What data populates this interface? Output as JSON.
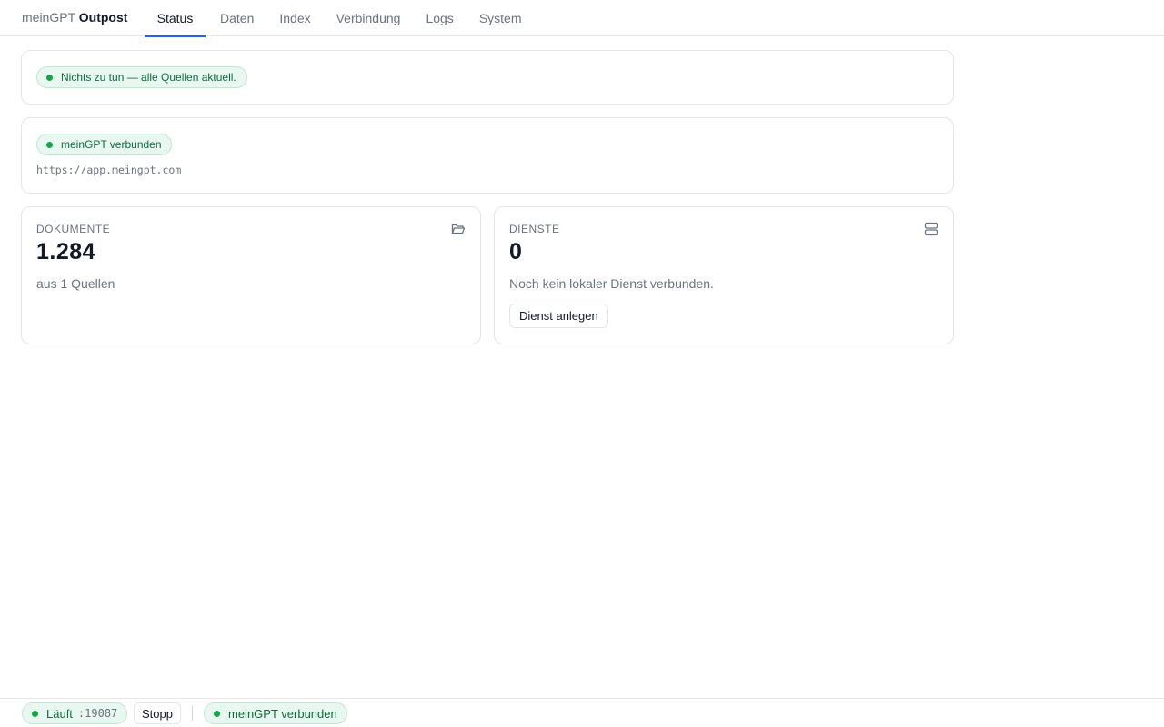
{
  "app": {
    "brand_prefix": "meinGPT",
    "brand_name": "Outpost"
  },
  "nav": {
    "tabs": [
      {
        "label": "Status",
        "active": true
      },
      {
        "label": "Daten"
      },
      {
        "label": "Index"
      },
      {
        "label": "Verbindung"
      },
      {
        "label": "Logs"
      },
      {
        "label": "System"
      }
    ]
  },
  "status_card": {
    "message": "Nichts zu tun — alle Quellen aktuell."
  },
  "connection_card": {
    "status": "meinGPT verbunden",
    "url": "https://app.meingpt.com"
  },
  "documents": {
    "label": "DOKUMENTE",
    "value": "1.284",
    "sub": "aus 1 Quellen",
    "icon": "folder-open-icon"
  },
  "services": {
    "label": "DIENSTE",
    "value": "0",
    "sub": "Noch kein lokaler Dienst verbunden.",
    "button": "Dienst anlegen",
    "icon": "server-icon"
  },
  "footer": {
    "running_label": "Läuft",
    "port": ":19087",
    "stop_button": "Stopp",
    "connection_status": "meinGPT verbunden"
  },
  "colors": {
    "accent": "#2563eb",
    "success": "#16a34a",
    "success_bg": "#e8f7ef"
  }
}
